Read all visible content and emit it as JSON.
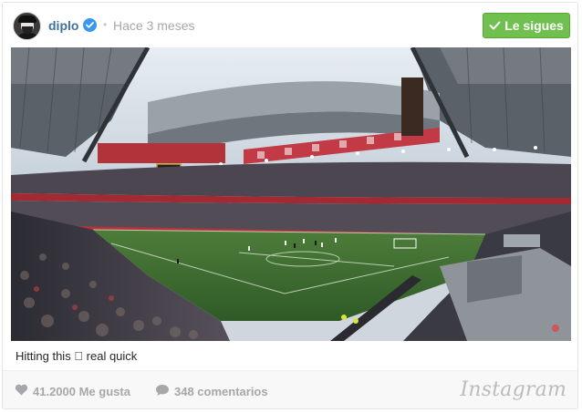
{
  "post": {
    "username": "diplo",
    "separator": "•",
    "timestamp": "Hace 3 meses",
    "follow_button": "Le sigues",
    "caption": "Hitting this 🏻 real quick",
    "likes": "41.2000 Me gusta",
    "comments": "348 comentarios",
    "brand": "Instagram"
  },
  "colors": {
    "username": "#3f729b",
    "verified": "#3897f0",
    "follow_button": "#70c050",
    "stat_text": "#a5a7aa"
  },
  "icons": {
    "verified": "verified-badge-icon",
    "follow_check": "checkmark-icon",
    "likes": "heart-icon",
    "comments": "comment-bubble-icon"
  },
  "image": {
    "subject": "stadium-panorama-photo"
  }
}
